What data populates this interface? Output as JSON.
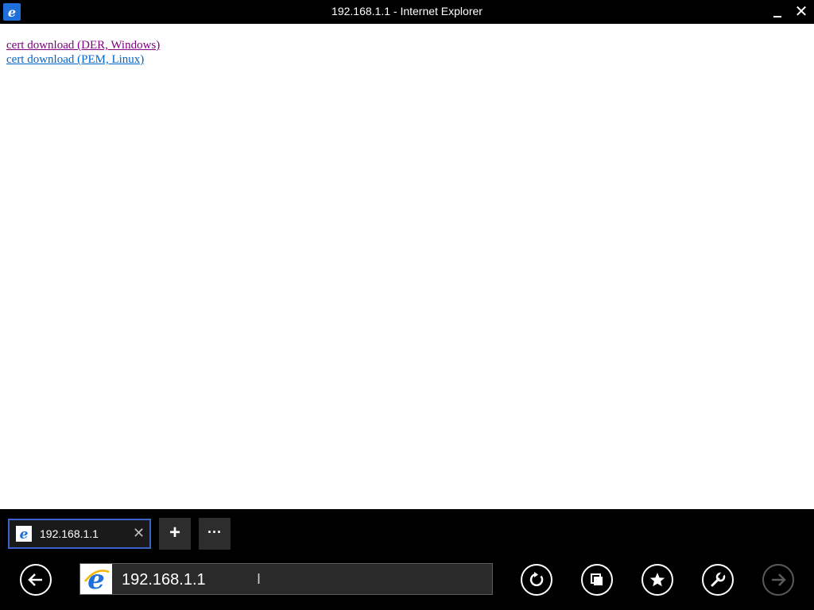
{
  "window": {
    "title": "192.168.1.1 - Internet Explorer",
    "minimize_icon": "minimize-icon",
    "close_glyph": "✕"
  },
  "page": {
    "links": [
      {
        "label": "cert download (DER, Windows)",
        "color": "#800080"
      },
      {
        "label": "cert download (PEM, Linux)",
        "color": "#0066cc"
      }
    ]
  },
  "tabs": {
    "items": [
      {
        "title": "192.168.1.1",
        "icon": "ie-icon",
        "close_glyph": "✕"
      }
    ],
    "new_tab_glyph": "+",
    "more_glyph": "···"
  },
  "nav": {
    "address_value": "192.168.1.1",
    "buttons": [
      "back-icon",
      "refresh-icon",
      "tabs-icon",
      "favorites-icon",
      "tools-icon",
      "forward-icon"
    ]
  },
  "colors": {
    "tab_border": "#3a64c8",
    "ie_blue": "#1e6fd9"
  }
}
